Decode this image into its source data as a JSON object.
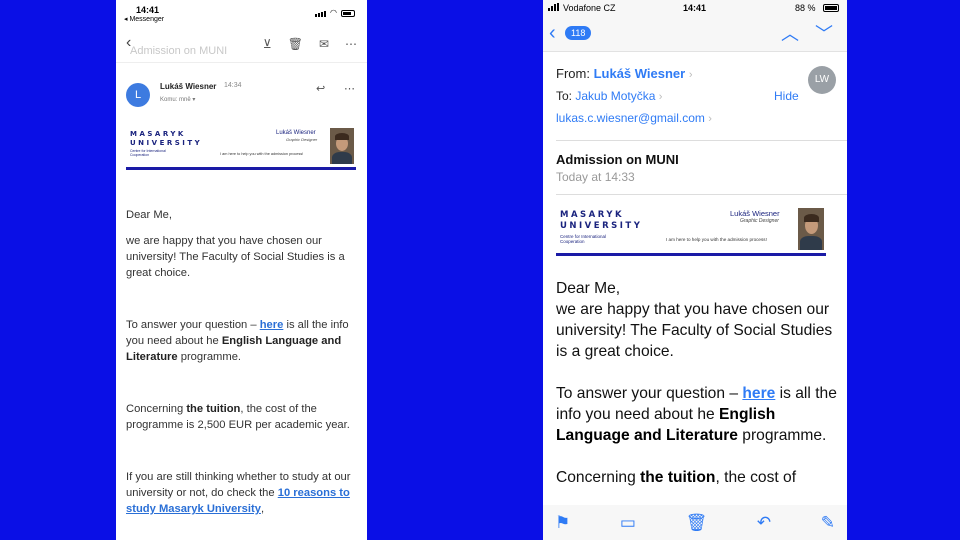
{
  "left_phone": {
    "status": {
      "time": "14:41",
      "back_app": "◂ Messenger"
    },
    "toolbar": {
      "back_icon": "chevron-left-icon",
      "icons": [
        "archive-icon",
        "trash-icon",
        "mail-icon",
        "more-icon"
      ]
    },
    "subject_faded": "Admission on MUNI",
    "sender": {
      "avatar_letter": "L",
      "name": "Lukáš Wiesner",
      "time": "14:34",
      "to": "Komu: mně ▾"
    },
    "banner": {
      "logo_line1": "MASARYK",
      "logo_line2": "UNIVERSITY",
      "cic": "Centre for International Cooperation",
      "name": "Lukáš Wiesner",
      "role": "Graphic Designer",
      "help": "I am here to help you with the admission process!"
    },
    "body": {
      "greeting": "Dear Me,",
      "p1": "we are happy that you have chosen our university! The Faculty of Social Studies is a great choice.",
      "p2_pre": "To answer your question – ",
      "p2_link": "here",
      "p2_mid": " is all the info you need about he ",
      "p2_bold": "English Language and Literature",
      "p2_post": " programme.",
      "p3_pre": "Concerning ",
      "p3_bold": "the tuition",
      "p3_post": ", the cost of the programme is 2,500 EUR per academic year.",
      "p4_pre": "If you are still thinking whether to study at our university or not, do check the ",
      "p4_link": "10 reasons to study Masaryk University",
      "p4_post": ","
    }
  },
  "right_phone": {
    "status": {
      "carrier": "Vodafone CZ",
      "time": "14:41",
      "battery": "88 %"
    },
    "navbar": {
      "badge": "118"
    },
    "from_label": "From:",
    "from_name": "Lukáš Wiesner",
    "to_label": "To:",
    "to_name": "Jakub Motyčka",
    "hide": "Hide",
    "avatar": "LW",
    "email": "lukas.c.wiesner@gmail.com",
    "subject": "Admission on MUNI",
    "date": "Today at 14:33",
    "banner": {
      "logo_line1": "MASARYK",
      "logo_line2": "UNIVERSITY",
      "cic": "Centre for International Cooperation",
      "name": "Lukáš Wiesner",
      "role": "Graphic Designer",
      "help": "I am here to help you with the admission process!"
    },
    "body": {
      "greeting": "Dear Me,",
      "p1": "we are happy that you have chosen our university! The Faculty of Social Studies is a great choice.",
      "p2_pre": "To answer your question – ",
      "p2_link": "here",
      "p2_mid": " is all the info you need about he ",
      "p2_bold": "English Language and Literature",
      "p2_post": " programme.",
      "p3_pre": "Concerning ",
      "p3_bold": "the tuition",
      "p3_post": ", the cost of"
    },
    "bottombar_icons": [
      "flag-icon",
      "folder-icon",
      "trash-icon",
      "reply-icon",
      "compose-icon"
    ]
  },
  "colors": {
    "background": "#0a0fe6",
    "ios_blue": "#2f7bf5",
    "gmail_link": "#2a6fd6",
    "banner_navy": "#1a237e"
  }
}
